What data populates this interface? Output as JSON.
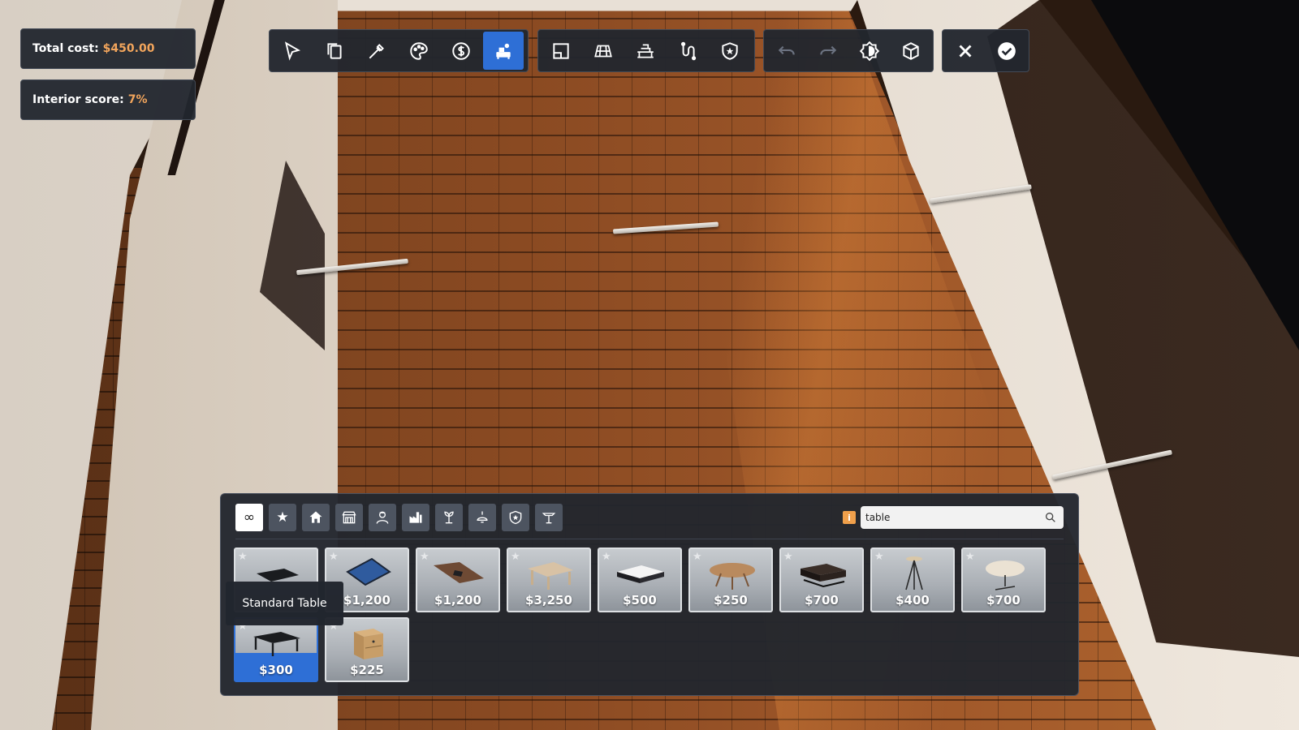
{
  "hud": {
    "total_cost_label": "Total cost:",
    "total_cost_value": "$450.00",
    "interior_score_label": "Interior score:",
    "interior_score_value": "7%"
  },
  "toolbar": {
    "active_tool": "place-furniture",
    "group1": [
      "select-arrow-icon",
      "copy-icon",
      "eyedropper-icon",
      "palette-icon",
      "dollar-icon",
      "place-furniture-icon"
    ],
    "group2": [
      "floor-plan-icon",
      "flooring-icon",
      "wall-shelf-icon",
      "path-icon",
      "shield-badge-icon"
    ],
    "group3": [
      "undo-icon",
      "redo-icon",
      "brightness-icon",
      "cube-view-icon"
    ],
    "group4": [
      "close-icon",
      "confirm-check-icon"
    ]
  },
  "catalog": {
    "tabs": [
      "infinity-icon",
      "star-icon",
      "home-icon",
      "store-icon",
      "worker-icon",
      "factory-icon",
      "plant-icon",
      "ceiling-lamp-icon",
      "security-shield-icon",
      "table-lamp-icon"
    ],
    "active_tab": "infinity-icon",
    "search": {
      "value": "table"
    },
    "info_badge": "i",
    "tooltip": "Standard Table",
    "items": [
      {
        "name": "dark-glass-table",
        "price": ""
      },
      {
        "name": "blue-glass-table",
        "price": "$1,200"
      },
      {
        "name": "conference-table",
        "price": "$1,200"
      },
      {
        "name": "wooden-dining-table",
        "price": "$3,250"
      },
      {
        "name": "white-coffee-table",
        "price": "$500"
      },
      {
        "name": "oval-wood-table",
        "price": "$250"
      },
      {
        "name": "dark-coffee-table",
        "price": "$700"
      },
      {
        "name": "tripod-side-table",
        "price": "$400"
      },
      {
        "name": "round-cafe-table",
        "price": "$700"
      },
      {
        "name": "standard-table",
        "price": "$300",
        "selected": true
      },
      {
        "name": "nightstand",
        "price": "$225"
      }
    ]
  },
  "colors": {
    "accent": "#2e6fd6",
    "highlight_value": "#f2a55c",
    "panel": "#22262e"
  }
}
